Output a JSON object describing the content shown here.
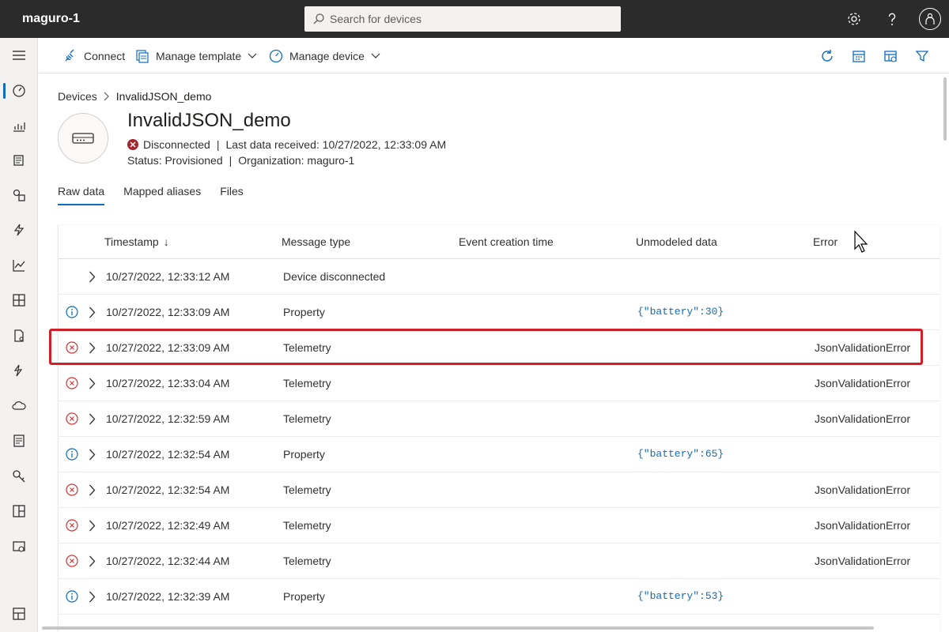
{
  "app": {
    "title": "maguro-1"
  },
  "search": {
    "placeholder": "Search for devices"
  },
  "commands": {
    "connect": "Connect",
    "manage_template": "Manage template",
    "manage_device": "Manage device"
  },
  "breadcrumb": {
    "root": "Devices",
    "current": "InvalidJSON_demo"
  },
  "device": {
    "name": "InvalidJSON_demo",
    "connection": "Disconnected",
    "last_data": "Last data received: 10/27/2022, 12:33:09 AM",
    "status": "Status: Provisioned",
    "organization": "Organization: maguro-1"
  },
  "tabs": [
    "Raw data",
    "Mapped aliases",
    "Files"
  ],
  "table": {
    "headers": {
      "timestamp": "Timestamp",
      "sort_indicator": "↓",
      "message_type": "Message type",
      "event_creation_time": "Event creation time",
      "unmodeled_data": "Unmodeled data",
      "error": "Error"
    },
    "rows": [
      {
        "status": "none",
        "timestamp": "10/27/2022, 12:33:12 AM",
        "message_type": "Device disconnected",
        "unmodeled": "",
        "error": ""
      },
      {
        "status": "info",
        "timestamp": "10/27/2022, 12:33:09 AM",
        "message_type": "Property",
        "unmodeled": "{\"battery\":30}",
        "error": ""
      },
      {
        "status": "error",
        "timestamp": "10/27/2022, 12:33:09 AM",
        "message_type": "Telemetry",
        "unmodeled": "",
        "error": "JsonValidationError"
      },
      {
        "status": "error",
        "timestamp": "10/27/2022, 12:33:04 AM",
        "message_type": "Telemetry",
        "unmodeled": "",
        "error": "JsonValidationError"
      },
      {
        "status": "error",
        "timestamp": "10/27/2022, 12:32:59 AM",
        "message_type": "Telemetry",
        "unmodeled": "",
        "error": "JsonValidationError"
      },
      {
        "status": "info",
        "timestamp": "10/27/2022, 12:32:54 AM",
        "message_type": "Property",
        "unmodeled": "{\"battery\":65}",
        "error": ""
      },
      {
        "status": "error",
        "timestamp": "10/27/2022, 12:32:54 AM",
        "message_type": "Telemetry",
        "unmodeled": "",
        "error": "JsonValidationError"
      },
      {
        "status": "error",
        "timestamp": "10/27/2022, 12:32:49 AM",
        "message_type": "Telemetry",
        "unmodeled": "",
        "error": "JsonValidationError"
      },
      {
        "status": "error",
        "timestamp": "10/27/2022, 12:32:44 AM",
        "message_type": "Telemetry",
        "unmodeled": "",
        "error": "JsonValidationError"
      },
      {
        "status": "info",
        "timestamp": "10/27/2022, 12:32:39 AM",
        "message_type": "Property",
        "unmodeled": "{\"battery\":53}",
        "error": ""
      }
    ]
  },
  "colors": {
    "accent": "#0f6cbd",
    "error": "#d13438",
    "highlight": "#d21f27",
    "topbar": "#2b2b2b"
  },
  "icons": {
    "nav": [
      "dashboard-icon",
      "analytics-icon",
      "device-templates-icon",
      "device-groups-icon",
      "rules-icon",
      "chart-icon",
      "layout-icon",
      "jobs-icon",
      "data-transform-icon",
      "cloud-export-icon",
      "audit-icon",
      "permissions-icon",
      "apps-icon",
      "settings-icon",
      "customize-icon"
    ]
  }
}
